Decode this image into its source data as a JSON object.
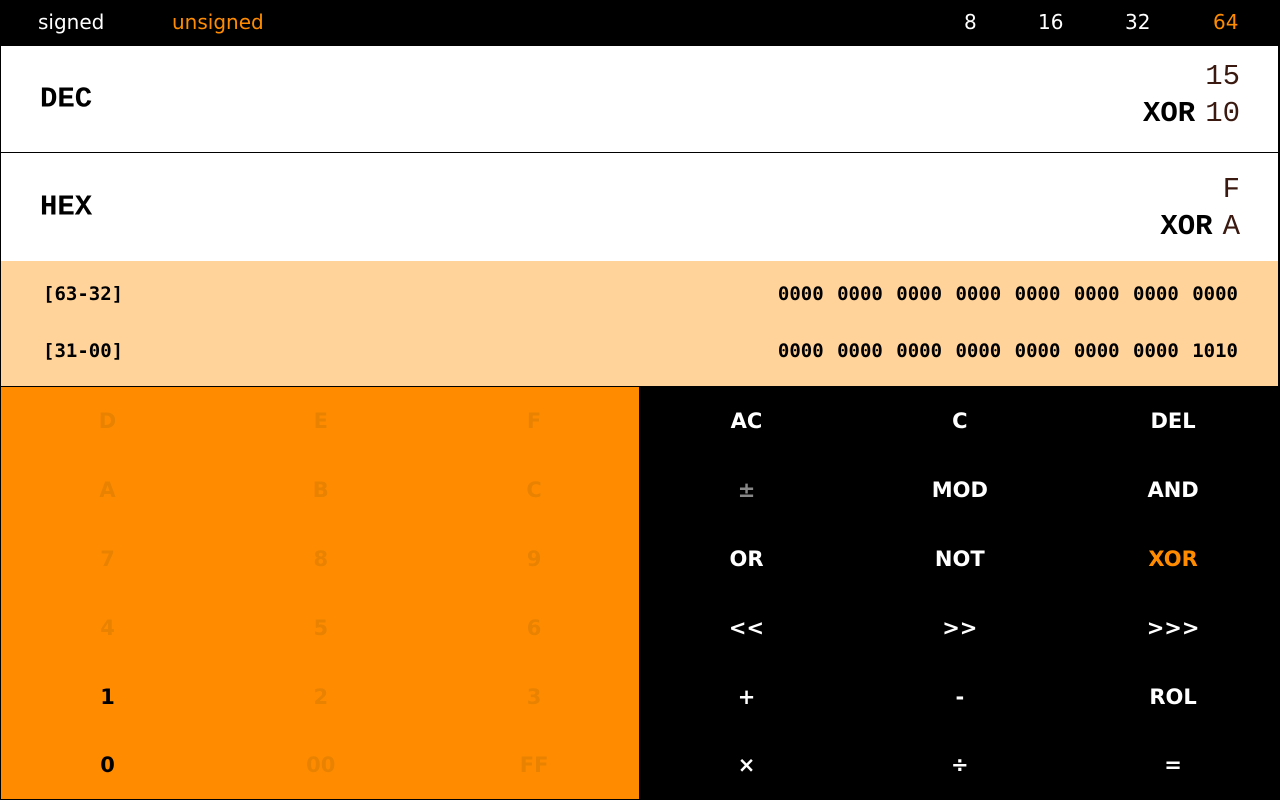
{
  "topbar": {
    "modes": [
      {
        "label": "signed",
        "active": false
      },
      {
        "label": "unsigned",
        "active": true
      }
    ],
    "widths": [
      {
        "label": "8",
        "active": false
      },
      {
        "label": "16",
        "active": false
      },
      {
        "label": "32",
        "active": false
      },
      {
        "label": "64",
        "active": true
      }
    ]
  },
  "dec": {
    "label": "DEC",
    "operand1": "15",
    "operator": "XOR",
    "operand2": "10"
  },
  "hex": {
    "label": "HEX",
    "operand1": "F",
    "operator": "XOR",
    "operand2": "A"
  },
  "binary": {
    "rows": [
      {
        "range": "[63-32]",
        "bits": "0000 0000 0000 0000 0000 0000 0000 0000"
      },
      {
        "range": "[31-00]",
        "bits": "0000 0000 0000 0000 0000 0000 0000 1010"
      }
    ]
  },
  "digits": [
    {
      "label": "D",
      "enabled": false
    },
    {
      "label": "E",
      "enabled": false
    },
    {
      "label": "F",
      "enabled": false
    },
    {
      "label": "A",
      "enabled": false
    },
    {
      "label": "B",
      "enabled": false
    },
    {
      "label": "C",
      "enabled": false
    },
    {
      "label": "7",
      "enabled": false
    },
    {
      "label": "8",
      "enabled": false
    },
    {
      "label": "9",
      "enabled": false
    },
    {
      "label": "4",
      "enabled": false
    },
    {
      "label": "5",
      "enabled": false
    },
    {
      "label": "6",
      "enabled": false
    },
    {
      "label": "1",
      "enabled": true
    },
    {
      "label": "2",
      "enabled": false
    },
    {
      "label": "3",
      "enabled": false
    },
    {
      "label": "0",
      "enabled": true
    },
    {
      "label": "00",
      "enabled": false
    },
    {
      "label": "FF",
      "enabled": false
    }
  ],
  "operators": [
    {
      "label": "AC",
      "state": "normal"
    },
    {
      "label": "C",
      "state": "normal"
    },
    {
      "label": "DEL",
      "state": "normal"
    },
    {
      "label": "±",
      "state": "disabled"
    },
    {
      "label": "MOD",
      "state": "normal"
    },
    {
      "label": "AND",
      "state": "normal"
    },
    {
      "label": "OR",
      "state": "normal"
    },
    {
      "label": "NOT",
      "state": "normal"
    },
    {
      "label": "XOR",
      "state": "selected"
    },
    {
      "label": "<<",
      "state": "normal"
    },
    {
      "label": ">>",
      "state": "normal"
    },
    {
      "label": ">>>",
      "state": "normal"
    },
    {
      "label": "+",
      "state": "normal"
    },
    {
      "label": "-",
      "state": "normal"
    },
    {
      "label": "ROL",
      "state": "normal"
    },
    {
      "label": "×",
      "state": "normal"
    },
    {
      "label": "÷",
      "state": "normal"
    },
    {
      "label": "=",
      "state": "normal"
    }
  ],
  "colors": {
    "accent": "#ff8c00",
    "binary_bg": "#ffd39a",
    "disabled_digit": "#e88200"
  }
}
